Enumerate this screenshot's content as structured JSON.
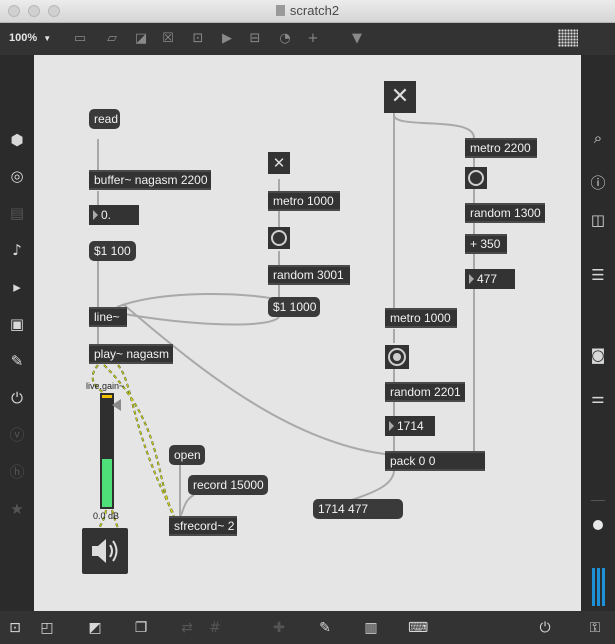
{
  "window": {
    "title": "scratch2"
  },
  "toolbar": {
    "zoom": "100%",
    "zoom_arrow": "▼"
  },
  "objects": {
    "read": "read",
    "buffer": "buffer~ nagasm 2200",
    "num_zero": "0.",
    "msg_ramp": "$1 100",
    "line": "line~",
    "play": "play~ nagasm",
    "metro1": "metro 1000",
    "random3001": "random 3001",
    "msg_1000": "$1 1000",
    "metro_big": "metro 1000",
    "random2201": "random 2201",
    "num1714": "1714",
    "pack": "pack 0 0",
    "msg_out": "1714 477",
    "metro2200": "metro 2200",
    "random1300": "random 1300",
    "plus350": "+ 350",
    "num477": "477",
    "open": "open",
    "record": "record 15000",
    "sfrecord": "sfrecord~ 2"
  },
  "gain": {
    "label": "live.gain~",
    "value": "0.0 dB",
    "level": 0.43
  }
}
